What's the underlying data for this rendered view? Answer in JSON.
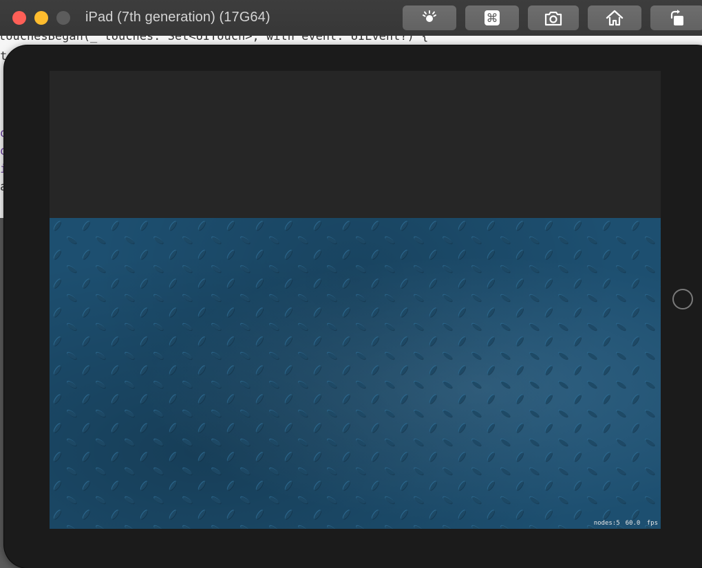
{
  "window": {
    "title": "iPad (7th generation) (17G64)",
    "traffic_lights": [
      "close",
      "minimize",
      "zoom"
    ]
  },
  "toolbar": {
    "buttons": [
      {
        "name": "brightness-icon"
      },
      {
        "name": "command-icon"
      },
      {
        "name": "screenshot-icon"
      },
      {
        "name": "home-icon"
      },
      {
        "name": "rotate-icon"
      }
    ]
  },
  "editor": {
    "visible_line": "touchesBegan(_ touches: Set<UITouch>, with event: UIEvent?) {"
  },
  "scene": {
    "nodes_label": "nodes:5",
    "fps_label": "60.0 fps"
  },
  "colors": {
    "titlebar": "#3b3b3b",
    "device_bezel": "#1b1b1b",
    "scene_background": "#262626",
    "plate_blue": "#1d4f70"
  }
}
